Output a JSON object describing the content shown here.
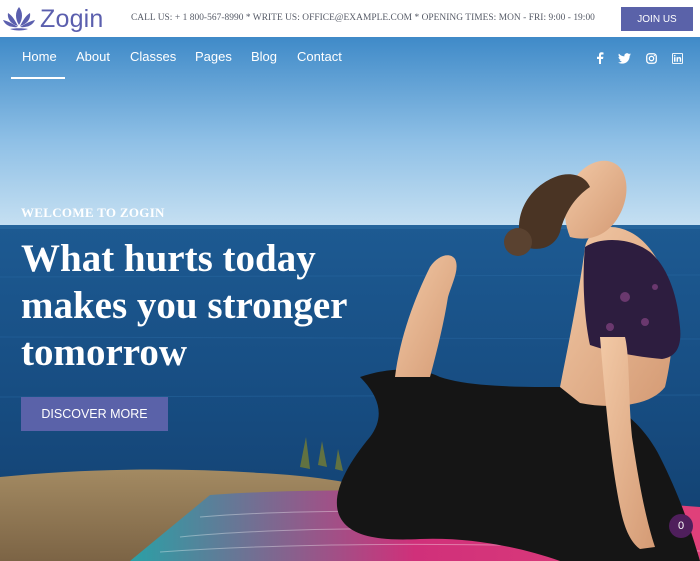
{
  "brand": {
    "name": "Zogin",
    "logo_icon": "lotus-icon",
    "color": "#5b5fae"
  },
  "topbar": {
    "contact_info": "CALL US: + 1 800-567-8990 * WRITE US: OFFICE@EXAMPLE.COM * OPENING TIMES: MON - FRI: 9:00 - 19:00",
    "join_label": "JOIN US"
  },
  "nav": {
    "items": [
      "Home",
      "About",
      "Classes",
      "Pages",
      "Blog",
      "Contact"
    ],
    "active": "Home",
    "social_icons": [
      "facebook-icon",
      "twitter-icon",
      "instagram-icon",
      "linkedin-icon"
    ]
  },
  "hero": {
    "eyebrow": "WELCOME TO ZOGIN",
    "headline_lines": [
      "What hurts today",
      "makes you stronger",
      "tomorrow"
    ],
    "cta_label": "DISCOVER MORE"
  },
  "cart": {
    "count": "0"
  },
  "colors": {
    "accent": "#5a62a9",
    "cart_badge": "#4f1f5c",
    "text_dark": "#555a66"
  }
}
